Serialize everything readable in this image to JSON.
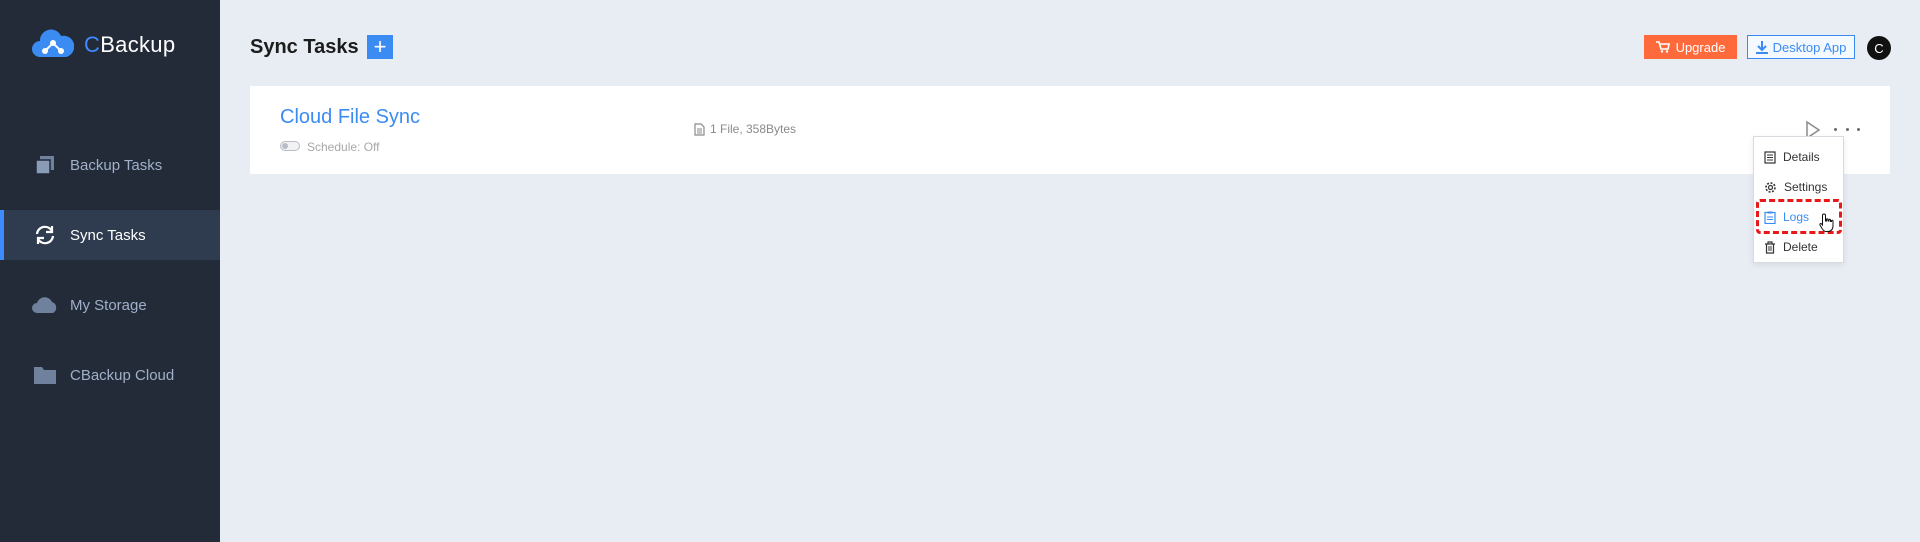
{
  "app": {
    "logo_c": "C",
    "logo_rest": "Backup"
  },
  "sidebar": {
    "items": [
      {
        "label": "Backup Tasks",
        "icon": "backup-tasks-icon"
      },
      {
        "label": "Sync Tasks",
        "icon": "sync-icon",
        "active": true
      },
      {
        "label": "My Storage",
        "icon": "cloud-icon"
      },
      {
        "label": "CBackup Cloud",
        "icon": "folder-icon"
      }
    ]
  },
  "header": {
    "title": "Sync Tasks",
    "add_label": "+",
    "upgrade_label": "Upgrade",
    "desktop_label": "Desktop App",
    "avatar_initial": "C"
  },
  "task": {
    "name": "Cloud File Sync",
    "schedule": "Schedule: Off",
    "file_info": "1 File, 358Bytes"
  },
  "menu": {
    "items": [
      {
        "label": "Details",
        "icon": "details-icon"
      },
      {
        "label": "Settings",
        "icon": "gear-icon"
      },
      {
        "label": "Logs",
        "icon": "logs-icon",
        "highlighted": true
      },
      {
        "label": "Delete",
        "icon": "trash-icon"
      }
    ]
  },
  "colors": {
    "sidebar_bg": "#232b39",
    "accent": "#3b8cf2",
    "upgrade": "#ff6a3d",
    "highlight": "#e81818",
    "page_bg": "#e8ecf3"
  }
}
